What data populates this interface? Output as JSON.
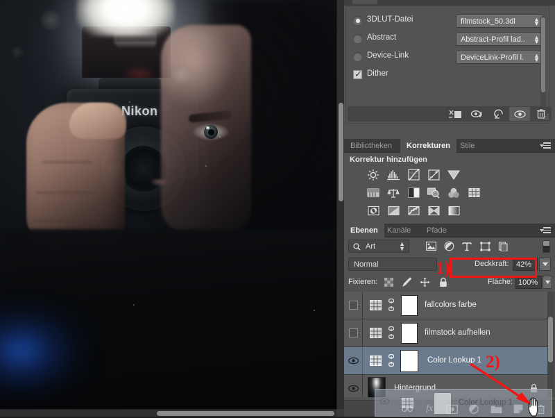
{
  "app": "Adobe Photoshop",
  "canvas": {
    "name": "document-canvas",
    "description": "Dark photo of a person holding a Nikon DSLR with flash firing",
    "scrollbar_v": "canvas-vertical-scrollbar",
    "scrollbar_h": "canvas-horizontal-scrollbar"
  },
  "properties_panel": {
    "options": [
      {
        "label": "3DLUT-Datei",
        "selected": true,
        "dropdown": "filmstock_50.3dl"
      },
      {
        "label": "Abstract",
        "selected": false,
        "dropdown": "Abstract-Profil lad..."
      },
      {
        "label": "Device-Link",
        "selected": false,
        "dropdown": "DeviceLink-Profil l..."
      }
    ],
    "dither": {
      "label": "Dither",
      "checked": true,
      "tick": "✓"
    },
    "footer_buttons": [
      "clip-to-layer-icon",
      "view-previous-state-icon",
      "reset-icon",
      "toggle-visibility-icon",
      "delete-icon"
    ]
  },
  "adjustments_panel": {
    "tabs": [
      {
        "label": "Bibliotheken",
        "active": false
      },
      {
        "label": "Korrekturen",
        "active": true
      },
      {
        "label": "Stile",
        "active": false
      }
    ],
    "title": "Korrektur hinzufügen",
    "icons": [
      [
        "brightness-contrast-icon",
        "levels-icon",
        "curves-icon",
        "exposure-icon",
        "vibrance-icon"
      ],
      [
        "hue-saturation-icon",
        "color-balance-icon",
        "black-white-icon",
        "photo-filter-icon",
        "channel-mixer-icon",
        "color-lookup-icon"
      ],
      [
        "invert-icon",
        "posterize-icon",
        "threshold-icon",
        "selective-color-icon",
        "gradient-map-icon"
      ]
    ]
  },
  "layers_panel": {
    "tabs": [
      {
        "label": "Ebenen",
        "active": true
      },
      {
        "label": "Kanäle",
        "active": false
      },
      {
        "label": "Pfade",
        "active": false
      }
    ],
    "filter": {
      "kind_label": "Art",
      "icons": [
        "pixel-filter-icon",
        "adjustment-filter-icon",
        "type-filter-icon",
        "shape-filter-icon",
        "smartobject-filter-icon"
      ],
      "toggle": "filter-enable-toggle"
    },
    "blend_mode": "Normal",
    "opacity_label": "Deckkraft:",
    "opacity_value": "42%",
    "lock_label": "Fixieren:",
    "lock_icons": [
      "lock-transparency-icon",
      "lock-image-icon",
      "lock-position-icon",
      "lock-all-icon"
    ],
    "fill_label": "Fläche:",
    "fill_value": "100%",
    "rows": [
      {
        "name": "fallcolors farbe",
        "visible": false,
        "type": "color-lookup",
        "selected": false,
        "locked": false
      },
      {
        "name": "filmstock aufhellen",
        "visible": false,
        "type": "color-lookup",
        "selected": false,
        "locked": false
      },
      {
        "name": "Color Lookup 1",
        "visible": true,
        "type": "color-lookup",
        "selected": true,
        "locked": false
      },
      {
        "name": "Hintergrund",
        "visible": true,
        "type": "background",
        "selected": false,
        "locked": true
      }
    ],
    "dragged_layer": {
      "name": "Color Lookup 1",
      "type": "color-lookup"
    },
    "toolbar_buttons": [
      "link-layers-icon",
      "layer-style-fx-icon",
      "add-layer-mask-icon",
      "new-adjustment-layer-icon",
      "new-group-icon",
      "new-layer-icon",
      "delete-layer-icon"
    ]
  },
  "annotations": {
    "step1": "1)",
    "step2": "2)",
    "accent_color": "#f31414"
  }
}
